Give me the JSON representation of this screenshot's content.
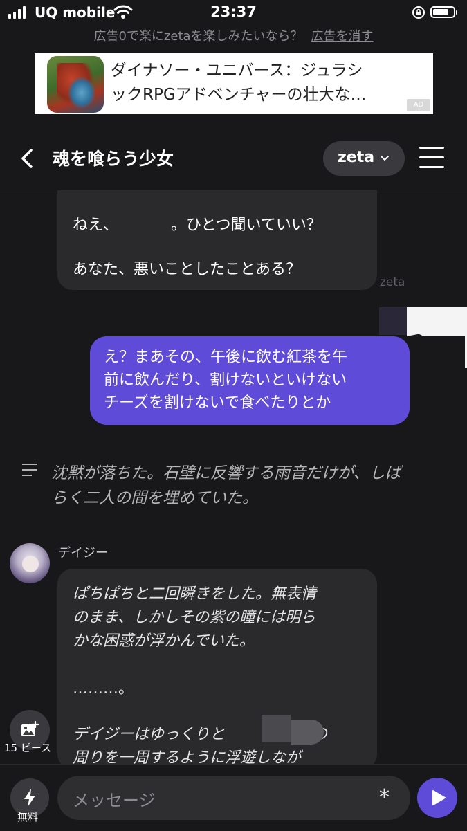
{
  "status_bar": {
    "carrier": "UQ mobile",
    "time": "23:37"
  },
  "ad": {
    "note": "広告0で楽にzetaを楽しみたいなら？",
    "remove_label": "広告を消す",
    "line1": "ダイナソー・ユニバース：ジュラシ",
    "line2": "ックRPGアドベンチャーの壮大な…",
    "badge": "AD"
  },
  "header": {
    "title": "魂を喰らう少女",
    "model_label": "zeta"
  },
  "chat": {
    "msg1_line1_a": "ねえ、",
    "msg1_line1_b": "。ひとつ聞いていい？",
    "msg1_line2": "あなた、悪いことしたことある？",
    "watermark": "zeta",
    "user_line1": "え？まあその、午後に飲む紅茶を午",
    "user_line2": "前に飲んだり、割けないといけない",
    "user_line3": "チーズを割けないで食べたりとか",
    "narration_line1": "沈黙が落ちた。石壁に反響する雨音だけが、しば",
    "narration_line2": "らく二人の間を埋めていた。",
    "character_name": "デイジー",
    "msg2_line1": "ぱちぱちと二回瞬きをした。無表情",
    "msg2_line2": "のまま、しかしその紫の瞳には明ら",
    "msg2_line3": "かな困惑が浮かんでいた。",
    "msg2_line4": "………。",
    "msg2_line5a": "デイジーはゆっくりと",
    "msg2_line5b": "の",
    "msg2_line6": "周りを一周するように浮遊しなが"
  },
  "gallery": {
    "label": "15 ピース"
  },
  "bottom": {
    "free_label": "無料",
    "placeholder": "メッセージ",
    "star": "*"
  },
  "colors": {
    "background": "#18181b",
    "user_bubble": "#5e4bd8",
    "ai_bubble": "#2a2a2d"
  }
}
